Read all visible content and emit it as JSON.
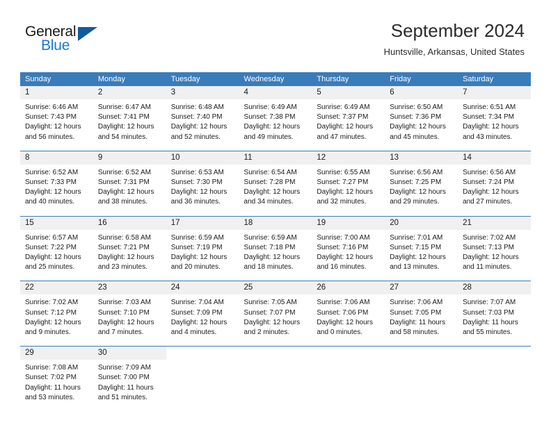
{
  "brand": {
    "name_part1": "General",
    "name_part2": "Blue"
  },
  "header": {
    "title": "September 2024",
    "subtitle": "Huntsville, Arkansas, United States"
  },
  "colors": {
    "header_blue": "#3a7cba",
    "day_band_gray": "#f0f0f0",
    "brand_blue": "#1e78c8",
    "flag_blue": "#115a9e"
  },
  "weekdays": [
    "Sunday",
    "Monday",
    "Tuesday",
    "Wednesday",
    "Thursday",
    "Friday",
    "Saturday"
  ],
  "weeks": [
    [
      {
        "day": "1",
        "sunrise": "Sunrise: 6:46 AM",
        "sunset": "Sunset: 7:43 PM",
        "daylight_line1": "Daylight: 12 hours",
        "daylight_line2": "and 56 minutes."
      },
      {
        "day": "2",
        "sunrise": "Sunrise: 6:47 AM",
        "sunset": "Sunset: 7:41 PM",
        "daylight_line1": "Daylight: 12 hours",
        "daylight_line2": "and 54 minutes."
      },
      {
        "day": "3",
        "sunrise": "Sunrise: 6:48 AM",
        "sunset": "Sunset: 7:40 PM",
        "daylight_line1": "Daylight: 12 hours",
        "daylight_line2": "and 52 minutes."
      },
      {
        "day": "4",
        "sunrise": "Sunrise: 6:49 AM",
        "sunset": "Sunset: 7:38 PM",
        "daylight_line1": "Daylight: 12 hours",
        "daylight_line2": "and 49 minutes."
      },
      {
        "day": "5",
        "sunrise": "Sunrise: 6:49 AM",
        "sunset": "Sunset: 7:37 PM",
        "daylight_line1": "Daylight: 12 hours",
        "daylight_line2": "and 47 minutes."
      },
      {
        "day": "6",
        "sunrise": "Sunrise: 6:50 AM",
        "sunset": "Sunset: 7:36 PM",
        "daylight_line1": "Daylight: 12 hours",
        "daylight_line2": "and 45 minutes."
      },
      {
        "day": "7",
        "sunrise": "Sunrise: 6:51 AM",
        "sunset": "Sunset: 7:34 PM",
        "daylight_line1": "Daylight: 12 hours",
        "daylight_line2": "and 43 minutes."
      }
    ],
    [
      {
        "day": "8",
        "sunrise": "Sunrise: 6:52 AM",
        "sunset": "Sunset: 7:33 PM",
        "daylight_line1": "Daylight: 12 hours",
        "daylight_line2": "and 40 minutes."
      },
      {
        "day": "9",
        "sunrise": "Sunrise: 6:52 AM",
        "sunset": "Sunset: 7:31 PM",
        "daylight_line1": "Daylight: 12 hours",
        "daylight_line2": "and 38 minutes."
      },
      {
        "day": "10",
        "sunrise": "Sunrise: 6:53 AM",
        "sunset": "Sunset: 7:30 PM",
        "daylight_line1": "Daylight: 12 hours",
        "daylight_line2": "and 36 minutes."
      },
      {
        "day": "11",
        "sunrise": "Sunrise: 6:54 AM",
        "sunset": "Sunset: 7:28 PM",
        "daylight_line1": "Daylight: 12 hours",
        "daylight_line2": "and 34 minutes."
      },
      {
        "day": "12",
        "sunrise": "Sunrise: 6:55 AM",
        "sunset": "Sunset: 7:27 PM",
        "daylight_line1": "Daylight: 12 hours",
        "daylight_line2": "and 32 minutes."
      },
      {
        "day": "13",
        "sunrise": "Sunrise: 6:56 AM",
        "sunset": "Sunset: 7:25 PM",
        "daylight_line1": "Daylight: 12 hours",
        "daylight_line2": "and 29 minutes."
      },
      {
        "day": "14",
        "sunrise": "Sunrise: 6:56 AM",
        "sunset": "Sunset: 7:24 PM",
        "daylight_line1": "Daylight: 12 hours",
        "daylight_line2": "and 27 minutes."
      }
    ],
    [
      {
        "day": "15",
        "sunrise": "Sunrise: 6:57 AM",
        "sunset": "Sunset: 7:22 PM",
        "daylight_line1": "Daylight: 12 hours",
        "daylight_line2": "and 25 minutes."
      },
      {
        "day": "16",
        "sunrise": "Sunrise: 6:58 AM",
        "sunset": "Sunset: 7:21 PM",
        "daylight_line1": "Daylight: 12 hours",
        "daylight_line2": "and 23 minutes."
      },
      {
        "day": "17",
        "sunrise": "Sunrise: 6:59 AM",
        "sunset": "Sunset: 7:19 PM",
        "daylight_line1": "Daylight: 12 hours",
        "daylight_line2": "and 20 minutes."
      },
      {
        "day": "18",
        "sunrise": "Sunrise: 6:59 AM",
        "sunset": "Sunset: 7:18 PM",
        "daylight_line1": "Daylight: 12 hours",
        "daylight_line2": "and 18 minutes."
      },
      {
        "day": "19",
        "sunrise": "Sunrise: 7:00 AM",
        "sunset": "Sunset: 7:16 PM",
        "daylight_line1": "Daylight: 12 hours",
        "daylight_line2": "and 16 minutes."
      },
      {
        "day": "20",
        "sunrise": "Sunrise: 7:01 AM",
        "sunset": "Sunset: 7:15 PM",
        "daylight_line1": "Daylight: 12 hours",
        "daylight_line2": "and 13 minutes."
      },
      {
        "day": "21",
        "sunrise": "Sunrise: 7:02 AM",
        "sunset": "Sunset: 7:13 PM",
        "daylight_line1": "Daylight: 12 hours",
        "daylight_line2": "and 11 minutes."
      }
    ],
    [
      {
        "day": "22",
        "sunrise": "Sunrise: 7:02 AM",
        "sunset": "Sunset: 7:12 PM",
        "daylight_line1": "Daylight: 12 hours",
        "daylight_line2": "and 9 minutes."
      },
      {
        "day": "23",
        "sunrise": "Sunrise: 7:03 AM",
        "sunset": "Sunset: 7:10 PM",
        "daylight_line1": "Daylight: 12 hours",
        "daylight_line2": "and 7 minutes."
      },
      {
        "day": "24",
        "sunrise": "Sunrise: 7:04 AM",
        "sunset": "Sunset: 7:09 PM",
        "daylight_line1": "Daylight: 12 hours",
        "daylight_line2": "and 4 minutes."
      },
      {
        "day": "25",
        "sunrise": "Sunrise: 7:05 AM",
        "sunset": "Sunset: 7:07 PM",
        "daylight_line1": "Daylight: 12 hours",
        "daylight_line2": "and 2 minutes."
      },
      {
        "day": "26",
        "sunrise": "Sunrise: 7:06 AM",
        "sunset": "Sunset: 7:06 PM",
        "daylight_line1": "Daylight: 12 hours",
        "daylight_line2": "and 0 minutes."
      },
      {
        "day": "27",
        "sunrise": "Sunrise: 7:06 AM",
        "sunset": "Sunset: 7:05 PM",
        "daylight_line1": "Daylight: 11 hours",
        "daylight_line2": "and 58 minutes."
      },
      {
        "day": "28",
        "sunrise": "Sunrise: 7:07 AM",
        "sunset": "Sunset: 7:03 PM",
        "daylight_line1": "Daylight: 11 hours",
        "daylight_line2": "and 55 minutes."
      }
    ],
    [
      {
        "day": "29",
        "sunrise": "Sunrise: 7:08 AM",
        "sunset": "Sunset: 7:02 PM",
        "daylight_line1": "Daylight: 11 hours",
        "daylight_line2": "and 53 minutes."
      },
      {
        "day": "30",
        "sunrise": "Sunrise: 7:09 AM",
        "sunset": "Sunset: 7:00 PM",
        "daylight_line1": "Daylight: 11 hours",
        "daylight_line2": "and 51 minutes."
      },
      {
        "day": "",
        "sunrise": "",
        "sunset": "",
        "daylight_line1": "",
        "daylight_line2": ""
      },
      {
        "day": "",
        "sunrise": "",
        "sunset": "",
        "daylight_line1": "",
        "daylight_line2": ""
      },
      {
        "day": "",
        "sunrise": "",
        "sunset": "",
        "daylight_line1": "",
        "daylight_line2": ""
      },
      {
        "day": "",
        "sunrise": "",
        "sunset": "",
        "daylight_line1": "",
        "daylight_line2": ""
      },
      {
        "day": "",
        "sunrise": "",
        "sunset": "",
        "daylight_line1": "",
        "daylight_line2": ""
      }
    ]
  ]
}
